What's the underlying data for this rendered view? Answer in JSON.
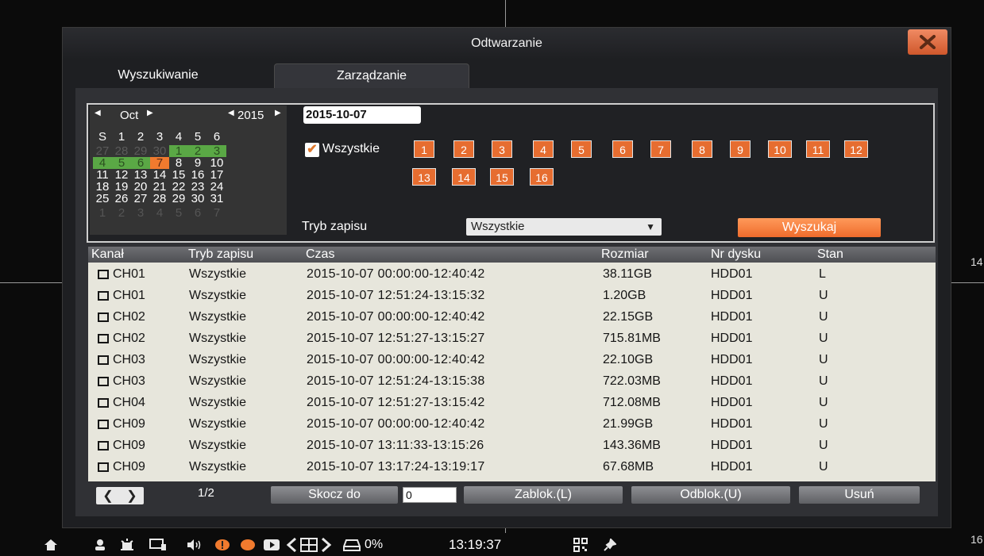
{
  "window": {
    "title": "Odtwarzanie"
  },
  "tabs": [
    {
      "label": "Wyszukiwanie"
    },
    {
      "label": "Zarządzanie"
    }
  ],
  "calendar": {
    "month": "Oct",
    "year": "2015",
    "weekdays": [
      "S",
      "1",
      "2",
      "3",
      "4",
      "5",
      "6"
    ],
    "weeks": [
      [
        "27",
        "28",
        "29",
        "30",
        "1",
        "2",
        "3"
      ],
      [
        "4",
        "5",
        "6",
        "7",
        "8",
        "9",
        "10"
      ],
      [
        "11",
        "12",
        "13",
        "14",
        "15",
        "16",
        "17"
      ],
      [
        "18",
        "19",
        "20",
        "21",
        "22",
        "23",
        "24"
      ],
      [
        "25",
        "26",
        "27",
        "28",
        "29",
        "30",
        "31"
      ],
      [
        "1",
        "2",
        "3",
        "4",
        "5",
        "6",
        "7"
      ]
    ],
    "selected_day": "7",
    "colors": {
      "recorded": "#5aa845",
      "selected": "#f07a2e"
    }
  },
  "search": {
    "date": "2015-10-07",
    "all_channels_label": "Wszystkie",
    "channels": [
      "1",
      "2",
      "3",
      "4",
      "5",
      "6",
      "7",
      "8",
      "9",
      "10",
      "11",
      "12",
      "13",
      "14",
      "15",
      "16"
    ],
    "mode_label": "Tryb zapisu",
    "mode_value": "Wszystkie",
    "search_button": "Wyszukaj"
  },
  "table": {
    "headers": [
      "Kanał",
      "Tryb zapisu",
      "Czas",
      "Rozmiar",
      "Nr dysku",
      "Stan"
    ],
    "rows": [
      {
        "channel": "CH01",
        "mode": "Wszystkie",
        "time": "2015-10-07 00:00:00-12:40:42",
        "size": "38.11GB",
        "disk": "HDD01",
        "state": "L"
      },
      {
        "channel": "CH01",
        "mode": "Wszystkie",
        "time": "2015-10-07 12:51:24-13:15:32",
        "size": "1.20GB",
        "disk": "HDD01",
        "state": "U"
      },
      {
        "channel": "CH02",
        "mode": "Wszystkie",
        "time": "2015-10-07 00:00:00-12:40:42",
        "size": "22.15GB",
        "disk": "HDD01",
        "state": "U"
      },
      {
        "channel": "CH02",
        "mode": "Wszystkie",
        "time": "2015-10-07 12:51:27-13:15:27",
        "size": "715.81MB",
        "disk": "HDD01",
        "state": "U"
      },
      {
        "channel": "CH03",
        "mode": "Wszystkie",
        "time": "2015-10-07 00:00:00-12:40:42",
        "size": "22.10GB",
        "disk": "HDD01",
        "state": "U"
      },
      {
        "channel": "CH03",
        "mode": "Wszystkie",
        "time": "2015-10-07 12:51:24-13:15:38",
        "size": "722.03MB",
        "disk": "HDD01",
        "state": "U"
      },
      {
        "channel": "CH04",
        "mode": "Wszystkie",
        "time": "2015-10-07 12:51:27-13:15:42",
        "size": "712.08MB",
        "disk": "HDD01",
        "state": "U"
      },
      {
        "channel": "CH09",
        "mode": "Wszystkie",
        "time": "2015-10-07 00:00:00-12:40:42",
        "size": "21.99GB",
        "disk": "HDD01",
        "state": "U"
      },
      {
        "channel": "CH09",
        "mode": "Wszystkie",
        "time": "2015-10-07 13:11:33-13:15:26",
        "size": "143.36MB",
        "disk": "HDD01",
        "state": "U"
      },
      {
        "channel": "CH09",
        "mode": "Wszystkie",
        "time": "2015-10-07 13:17:24-13:19:17",
        "size": "67.68MB",
        "disk": "HDD01",
        "state": "U"
      }
    ]
  },
  "footer": {
    "page": "1/2",
    "jump_label": "Skocz do",
    "jump_value": "0",
    "lock_label": "Zablok.(L)",
    "unlock_label": "Odblok.(U)",
    "delete_label": "Usuń"
  },
  "taskbar": {
    "disk_usage": "0%",
    "clock": "13:19:37"
  },
  "side_labels": {
    "top": "14",
    "bottom": "16"
  }
}
